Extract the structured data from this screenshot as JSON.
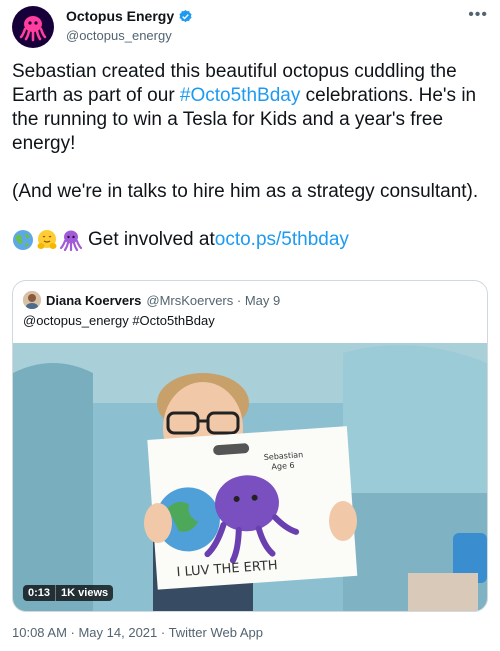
{
  "author": {
    "display_name": "Octopus Energy",
    "handle": "@octopus_energy"
  },
  "tweet": {
    "line1_a": "Sebastian created this beautiful octopus cuddling the Earth as part of our ",
    "hashtag": "#Octo5thBday",
    "line1_b": " celebrations. He's in the running to win a Tesla for Kids and a year's free energy!",
    "para2": "(And we're in talks to hire him as a strategy consultant).",
    "get_involved": "Get involved at ",
    "link": "octo.ps/5thbday",
    "emoji_icons": [
      "globe-icon",
      "hugging-face-icon",
      "octopus-icon"
    ]
  },
  "quote": {
    "display_name": "Diana Koervers",
    "meta": "@MrsKoervers · May 9",
    "text": "@octopus_energy  #Octo5thBday",
    "video_time": "0:13",
    "video_views": "1K views",
    "drawing_text": "I LUV THE ERTH"
  },
  "footer": {
    "timestamp": "10:08 AM · May 14, 2021 · Twitter Web App"
  },
  "colors": {
    "link": "#1d9bf0",
    "secondary": "#536471",
    "avatar_bg": "#17003a",
    "octopus": "#ff3e9e"
  }
}
